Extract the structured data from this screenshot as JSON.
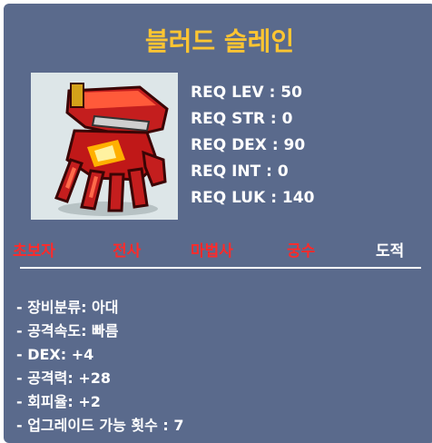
{
  "item": {
    "name": "블러드 슬레인",
    "icon": "red-glove-icon"
  },
  "requirements": [
    "REQ LEV : 50",
    "REQ STR : 0",
    "REQ DEX : 90",
    "REQ INT : 0",
    "REQ LUK : 140"
  ],
  "jobs": [
    {
      "label": "초보자",
      "available": false
    },
    {
      "label": "전사",
      "available": false
    },
    {
      "label": "마법사",
      "available": false
    },
    {
      "label": "궁수",
      "available": false
    },
    {
      "label": "도적",
      "available": true
    }
  ],
  "stats": [
    "- 장비분류: 아대",
    "- 공격속도: 빠름",
    "- DEX: +4",
    "- 공격력: +28",
    "- 회피율: +2",
    "- 업그레이드 가능 횟수 : 7"
  ],
  "colors": {
    "panel": "#5a6a8c",
    "title": "#ffc531",
    "job_unavailable": "#ff2a2a",
    "job_available": "#ffffff"
  }
}
